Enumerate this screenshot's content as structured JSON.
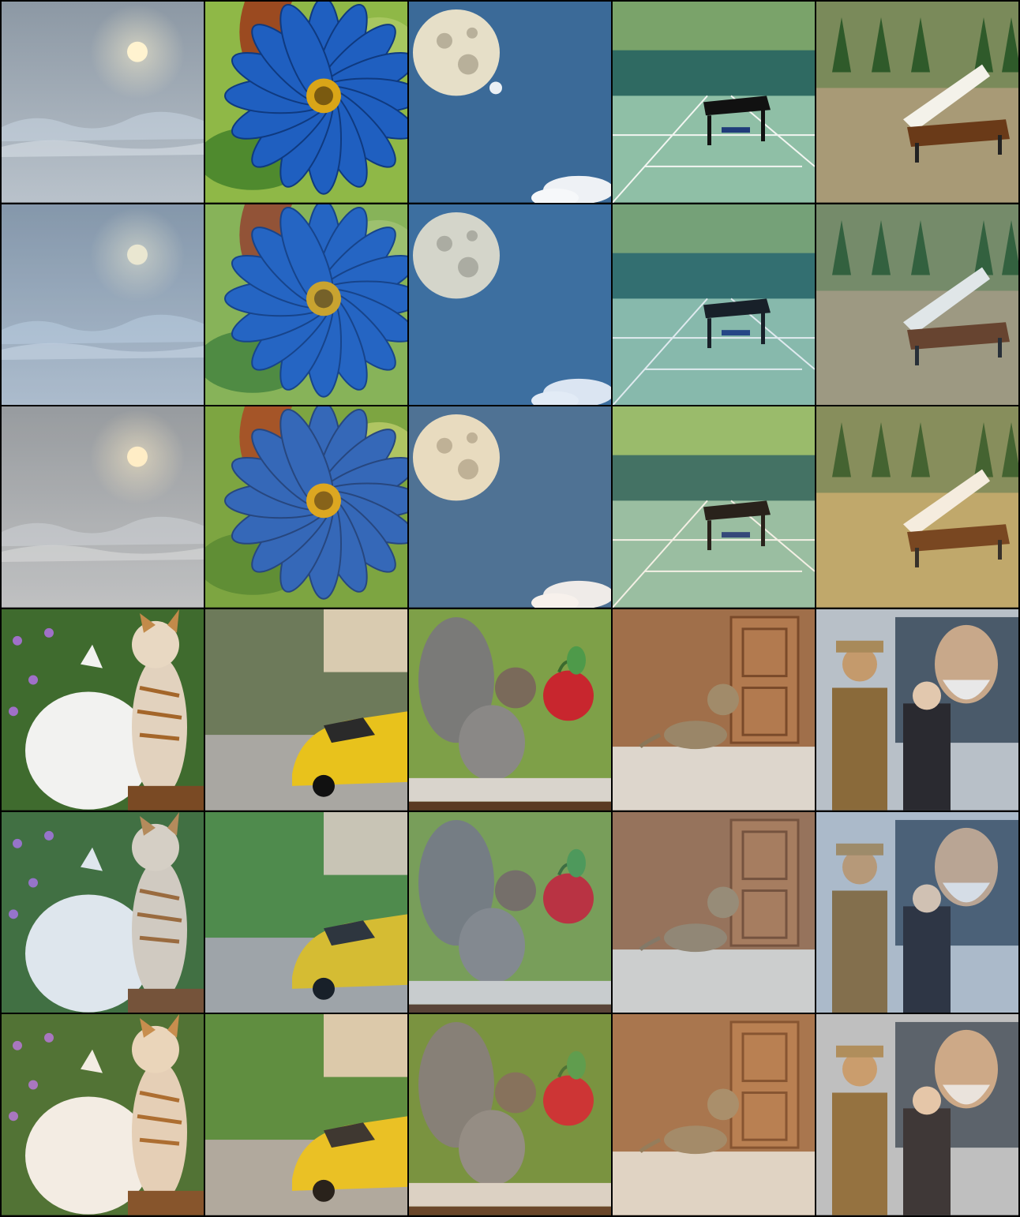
{
  "grid": {
    "columns": 5,
    "rows": 6,
    "cells": [
      {
        "subject": "moon-sky",
        "variant": "original"
      },
      {
        "subject": "horse-flower",
        "variant": "original"
      },
      {
        "subject": "full-moon",
        "variant": "original"
      },
      {
        "subject": "piano-tennis-court",
        "variant": "original"
      },
      {
        "subject": "piano-hillside",
        "variant": "original"
      },
      {
        "subject": "moon-sky",
        "variant": "stylized-a"
      },
      {
        "subject": "horse-flower",
        "variant": "stylized-a"
      },
      {
        "subject": "full-moon",
        "variant": "stylized-a"
      },
      {
        "subject": "piano-tennis-court",
        "variant": "stylized-a"
      },
      {
        "subject": "piano-hillside",
        "variant": "stylized-a"
      },
      {
        "subject": "moon-sky",
        "variant": "stylized-b"
      },
      {
        "subject": "horse-flower",
        "variant": "stylized-b"
      },
      {
        "subject": "full-moon",
        "variant": "stylized-b"
      },
      {
        "subject": "piano-tennis-court",
        "variant": "stylized-b"
      },
      {
        "subject": "piano-hillside",
        "variant": "stylized-b"
      },
      {
        "subject": "cats",
        "variant": "original"
      },
      {
        "subject": "yellow-car",
        "variant": "original"
      },
      {
        "subject": "squirrel-apple",
        "variant": "original"
      },
      {
        "subject": "cat-doorway",
        "variant": "original"
      },
      {
        "subject": "old-men-portrait",
        "variant": "original"
      },
      {
        "subject": "cats",
        "variant": "stylized-a"
      },
      {
        "subject": "yellow-car",
        "variant": "stylized-a"
      },
      {
        "subject": "squirrel-apple",
        "variant": "stylized-a"
      },
      {
        "subject": "cat-doorway",
        "variant": "stylized-a"
      },
      {
        "subject": "old-men-portrait",
        "variant": "stylized-a"
      },
      {
        "subject": "cats",
        "variant": "stylized-b"
      },
      {
        "subject": "yellow-car",
        "variant": "stylized-b"
      },
      {
        "subject": "squirrel-apple",
        "variant": "stylized-b"
      },
      {
        "subject": "cat-doorway",
        "variant": "stylized-b"
      },
      {
        "subject": "old-men-portrait",
        "variant": "stylized-b"
      }
    ]
  },
  "colors": {
    "border": "#000000",
    "sky_blue": "#3b6a98",
    "flower_blue": "#1f5fc0",
    "court_green": "#8fbfa6",
    "car_yellow": "#e8c21c",
    "apple_red": "#c8262e"
  }
}
